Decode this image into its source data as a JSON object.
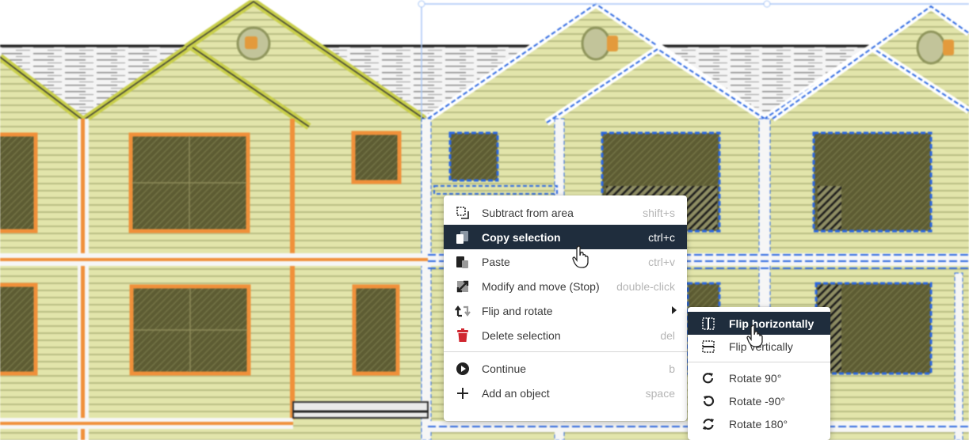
{
  "context_menu": {
    "items": [
      {
        "label": "Subtract from area",
        "shortcut": "shift+s",
        "icon": "subtract-area-icon"
      },
      {
        "label": "Copy selection",
        "shortcut": "ctrl+c",
        "icon": "copy-icon",
        "highlighted": true
      },
      {
        "label": "Paste",
        "shortcut": "ctrl+v",
        "icon": "paste-icon"
      },
      {
        "label": "Modify and move (Stop)",
        "shortcut": "double-click",
        "icon": "move-resize-icon"
      },
      {
        "label": "Flip and rotate",
        "shortcut": "",
        "icon": "flip-rotate-icon",
        "has_submenu": true
      },
      {
        "label": "Delete selection",
        "shortcut": "del",
        "icon": "trash-icon"
      },
      {
        "label": "Continue",
        "shortcut": "b",
        "icon": "play-circle-icon"
      },
      {
        "label": "Add an object",
        "shortcut": "space",
        "icon": "plus-icon"
      }
    ]
  },
  "submenu": {
    "items": [
      {
        "label": "Flip horizontally",
        "icon": "flip-horizontal-icon",
        "highlighted": true
      },
      {
        "label": "Flip vertically",
        "icon": "flip-vertical-icon"
      },
      {
        "label": "Rotate 90°",
        "icon": "rotate-cw-icon"
      },
      {
        "label": "Rotate -90°",
        "icon": "rotate-ccw-icon"
      },
      {
        "label": "Rotate 180°",
        "icon": "rotate-180-icon"
      }
    ]
  },
  "colors": {
    "highlight": "#1f2d3d",
    "siding": "#dfe3a8",
    "trim_orange": "#f0903a",
    "selection_blue": "#1f6fe8",
    "delete_red": "#d0262f"
  }
}
